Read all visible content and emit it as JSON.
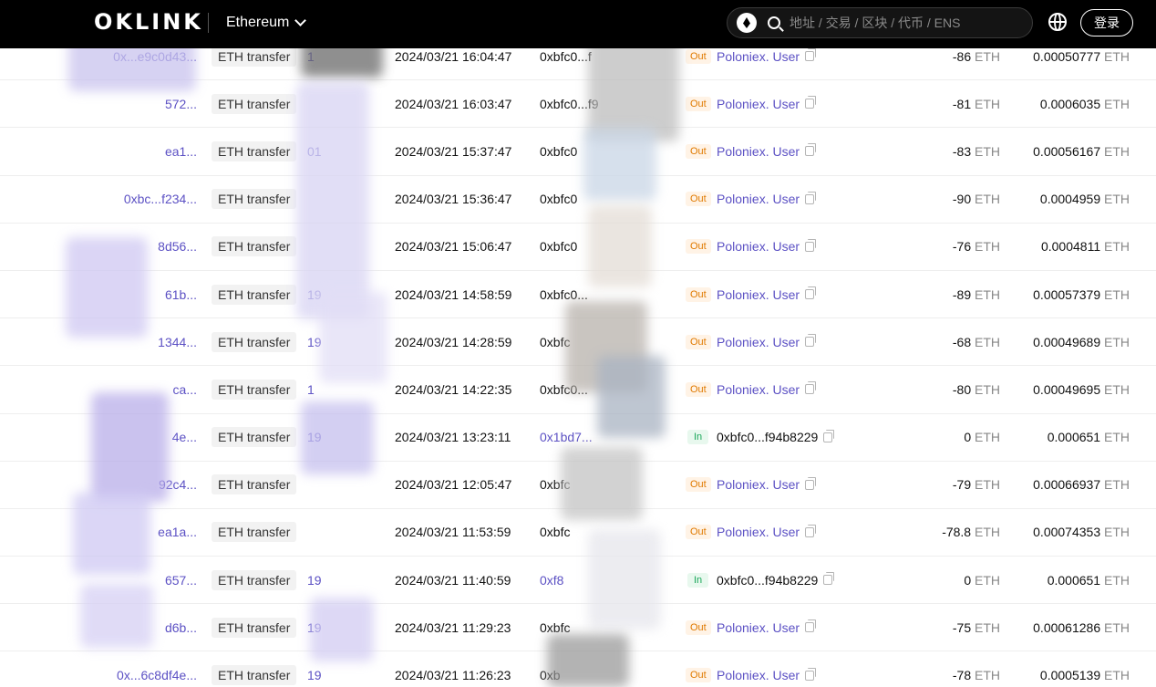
{
  "header": {
    "logo_text": "OKLINK",
    "chain_name": "Ethereum",
    "search_placeholder": "地址 / 交易 / 区块 / 代币 / ENS",
    "login_label": "登录"
  },
  "rows": [
    {
      "hash": "0x...e9c0d43...",
      "method": "ETH transfer",
      "block": "1",
      "time": "2024/03/21 16:04:47",
      "from": "0xbfc0...f",
      "from_link": false,
      "dir": "Out",
      "to": "Poloniex. User",
      "to_link": true,
      "amount": "-86",
      "fee": "0.00050777",
      "unit": "ETH"
    },
    {
      "hash": "572...",
      "method": "ETH transfer",
      "block": "",
      "time": "2024/03/21 16:03:47",
      "from": "0xbfc0...f9",
      "from_link": false,
      "dir": "Out",
      "to": "Poloniex. User",
      "to_link": true,
      "amount": "-81",
      "fee": "0.0006035",
      "unit": "ETH"
    },
    {
      "hash": "ea1...",
      "method": "ETH transfer",
      "block": "01",
      "time": "2024/03/21 15:37:47",
      "from": "0xbfc0",
      "from_link": false,
      "dir": "Out",
      "to": "Poloniex. User",
      "to_link": true,
      "amount": "-83",
      "fee": "0.00056167",
      "unit": "ETH"
    },
    {
      "hash": "0xbc...f234...",
      "method": "ETH transfer",
      "block": "",
      "time": "2024/03/21 15:36:47",
      "from": "0xbfc0",
      "from_link": false,
      "dir": "Out",
      "to": "Poloniex. User",
      "to_link": true,
      "amount": "-90",
      "fee": "0.0004959",
      "unit": "ETH"
    },
    {
      "hash": "8d56...",
      "method": "ETH transfer",
      "block": "",
      "time": "2024/03/21 15:06:47",
      "from": "0xbfc0",
      "from_link": false,
      "dir": "Out",
      "to": "Poloniex. User",
      "to_link": true,
      "amount": "-76",
      "fee": "0.0004811",
      "unit": "ETH"
    },
    {
      "hash": "61b...",
      "method": "ETH transfer",
      "block": "19",
      "time": "2024/03/21 14:58:59",
      "from": "0xbfc0...",
      "from_link": false,
      "dir": "Out",
      "to": "Poloniex. User",
      "to_link": true,
      "amount": "-89",
      "fee": "0.00057379",
      "unit": "ETH"
    },
    {
      "hash": "1344...",
      "method": "ETH transfer",
      "block": "19",
      "time": "2024/03/21 14:28:59",
      "from": "0xbfc",
      "from_link": false,
      "dir": "Out",
      "to": "Poloniex. User",
      "to_link": true,
      "amount": "-68",
      "fee": "0.00049689",
      "unit": "ETH"
    },
    {
      "hash": "ca...",
      "method": "ETH transfer",
      "block": "1",
      "time": "2024/03/21 14:22:35",
      "from": "0xbfc0...",
      "from_link": false,
      "dir": "Out",
      "to": "Poloniex. User",
      "to_link": true,
      "amount": "-80",
      "fee": "0.00049695",
      "unit": "ETH"
    },
    {
      "hash": "4e...",
      "method": "ETH transfer",
      "block": "19",
      "time": "2024/03/21 13:23:11",
      "from": "0x1bd7...",
      "from_link": true,
      "dir": "In",
      "to": "0xbfc0...f94b8229",
      "to_link": false,
      "amount": "0",
      "fee": "0.000651",
      "unit": "ETH"
    },
    {
      "hash": "92c4...",
      "method": "ETH transfer",
      "block": "",
      "time": "2024/03/21 12:05:47",
      "from": "0xbfc",
      "from_link": false,
      "dir": "Out",
      "to": "Poloniex. User",
      "to_link": true,
      "amount": "-79",
      "fee": "0.00066937",
      "unit": "ETH"
    },
    {
      "hash": "ea1a...",
      "method": "ETH transfer",
      "block": "",
      "time": "2024/03/21 11:53:59",
      "from": "0xbfc",
      "from_link": false,
      "dir": "Out",
      "to": "Poloniex. User",
      "to_link": true,
      "amount": "-78.8",
      "fee": "0.00074353",
      "unit": "ETH"
    },
    {
      "hash": "657...",
      "method": "ETH transfer",
      "block": "19",
      "time": "2024/03/21 11:40:59",
      "from": "0xf8",
      "from_link": true,
      "dir": "In",
      "to": "0xbfc0...f94b8229",
      "to_link": false,
      "amount": "0",
      "fee": "0.000651",
      "unit": "ETH"
    },
    {
      "hash": "d6b...",
      "method": "ETH transfer",
      "block": "19",
      "time": "2024/03/21 11:29:23",
      "from": "0xbfc",
      "from_link": false,
      "dir": "Out",
      "to": "Poloniex. User",
      "to_link": true,
      "amount": "-75",
      "fee": "0.00061286",
      "unit": "ETH"
    },
    {
      "hash": "0x...6c8df4e...",
      "method": "ETH transfer",
      "block": "19",
      "time": "2024/03/21 11:26:23",
      "from": "0xb",
      "from_link": false,
      "dir": "Out",
      "to": "Poloniex. User",
      "to_link": true,
      "amount": "-78",
      "fee": "0.0005139",
      "unit": "ETH"
    }
  ]
}
